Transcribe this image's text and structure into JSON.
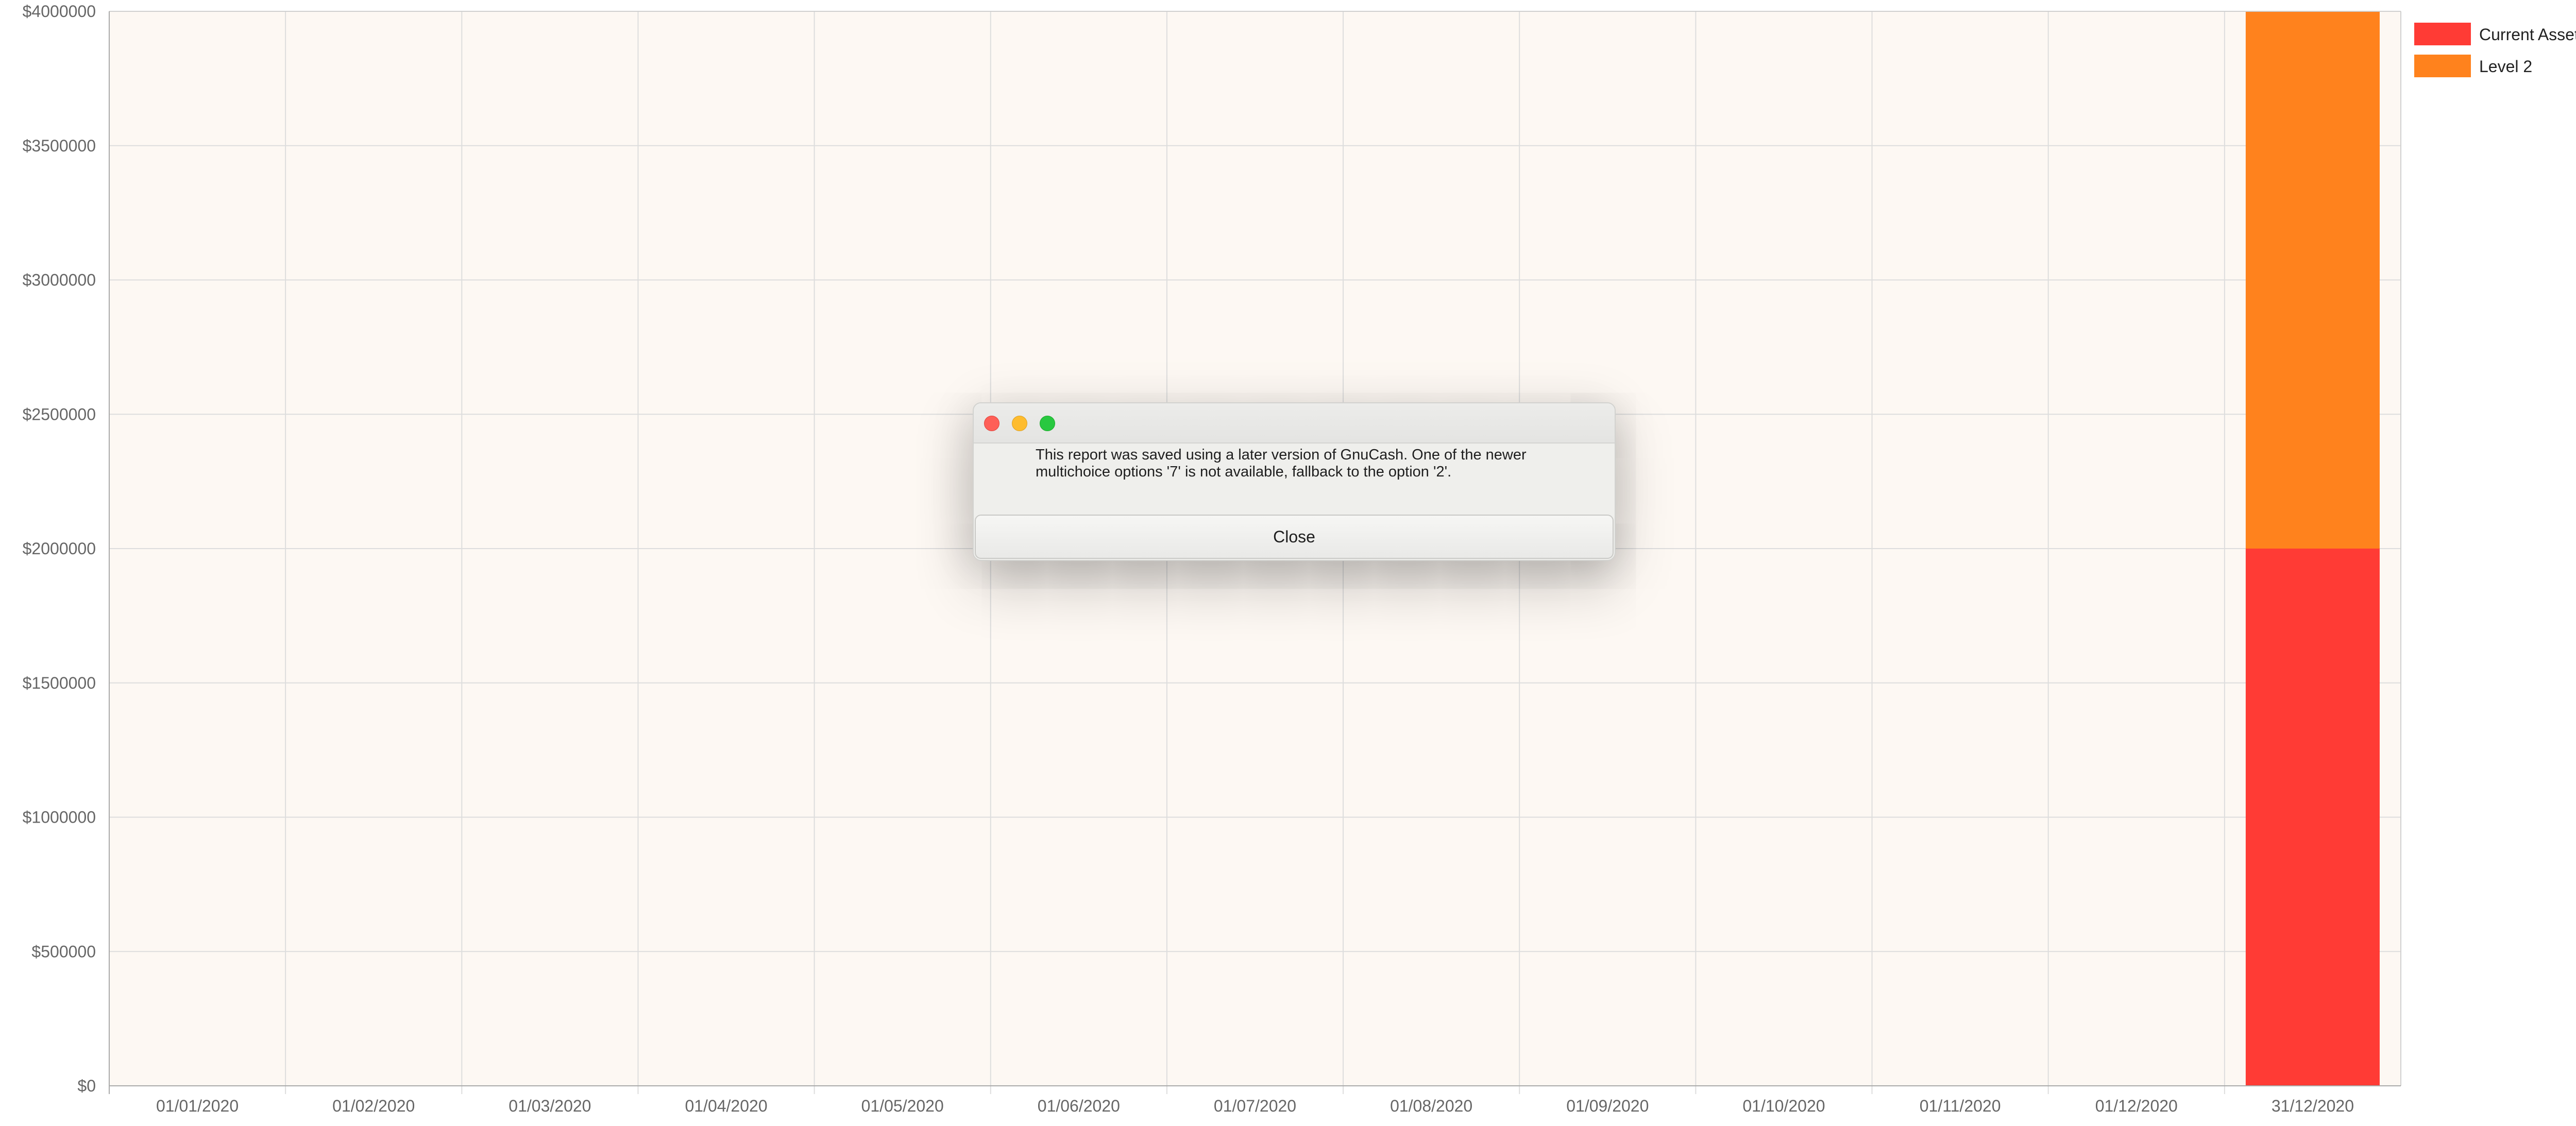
{
  "chart_data": {
    "type": "bar",
    "stacked": true,
    "categories": [
      "01/01/2020",
      "01/02/2020",
      "01/03/2020",
      "01/04/2020",
      "01/05/2020",
      "01/06/2020",
      "01/07/2020",
      "01/08/2020",
      "01/09/2020",
      "01/10/2020",
      "01/11/2020",
      "01/12/2020",
      "31/12/2020"
    ],
    "series": [
      {
        "name": "Current Assets",
        "color": "#ff3b35",
        "values": [
          0,
          0,
          0,
          0,
          0,
          0,
          0,
          0,
          0,
          0,
          0,
          0,
          2000000
        ]
      },
      {
        "name": "Level 2",
        "color": "#ff821d",
        "values": [
          0,
          0,
          0,
          0,
          0,
          0,
          0,
          0,
          0,
          0,
          0,
          0,
          2000000
        ]
      }
    ],
    "ylim": [
      0,
      4000000
    ],
    "y_ticks": [
      0,
      500000,
      1000000,
      1500000,
      2000000,
      2500000,
      3000000,
      3500000,
      4000000
    ],
    "y_tick_labels": [
      "$0",
      "$500000",
      "$1000000",
      "$1500000",
      "$2000000",
      "$2500000",
      "$3000000",
      "$3500000",
      "$4000000"
    ],
    "grid": true,
    "legend_position": "top-right",
    "plot_background": "#fdf8f3",
    "grid_color": "#dddddd"
  },
  "dialog": {
    "message": "This report was saved using a later version of GnuCash. One of the newer multichoice options '7' is not available, fallback to the option '2'.",
    "close_button_label": "Close"
  }
}
